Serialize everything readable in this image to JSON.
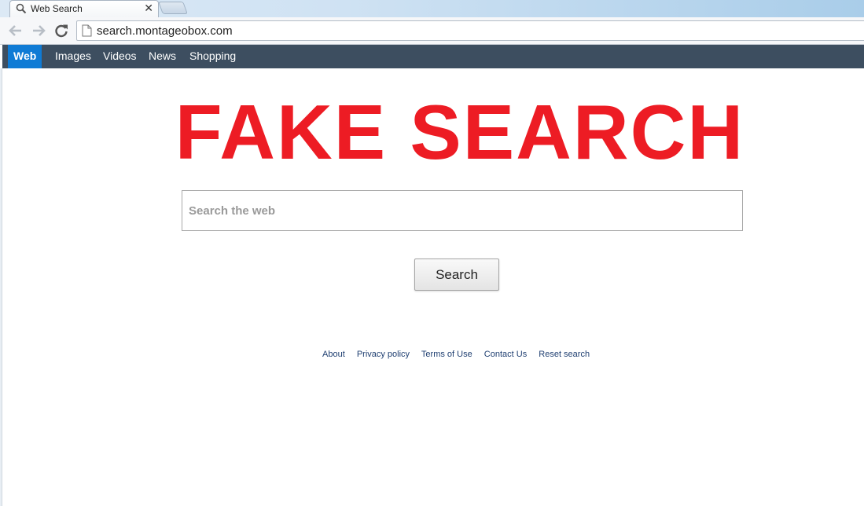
{
  "browser": {
    "tab": {
      "title": "Web Search",
      "close_glyph": "✕"
    },
    "address_bar": {
      "url": "search.montageobox.com"
    }
  },
  "site_nav": {
    "items": [
      {
        "label": "Web",
        "active": true
      },
      {
        "label": "Images",
        "active": false
      },
      {
        "label": "Videos",
        "active": false
      },
      {
        "label": "News",
        "active": false
      },
      {
        "label": "Shopping",
        "active": false
      }
    ]
  },
  "banner": {
    "text": "FAKE SEARCH",
    "color": "#ed1c24"
  },
  "search": {
    "placeholder": "Search the web",
    "value": "",
    "button_label": "Search"
  },
  "footer": {
    "links": [
      "About",
      "Privacy policy",
      "Terms of Use",
      "Contact Us",
      "Reset search"
    ]
  },
  "colors": {
    "nav_background": "#3d4e60",
    "nav_active": "#0f7bd5",
    "footer_link": "#1f3f71"
  }
}
